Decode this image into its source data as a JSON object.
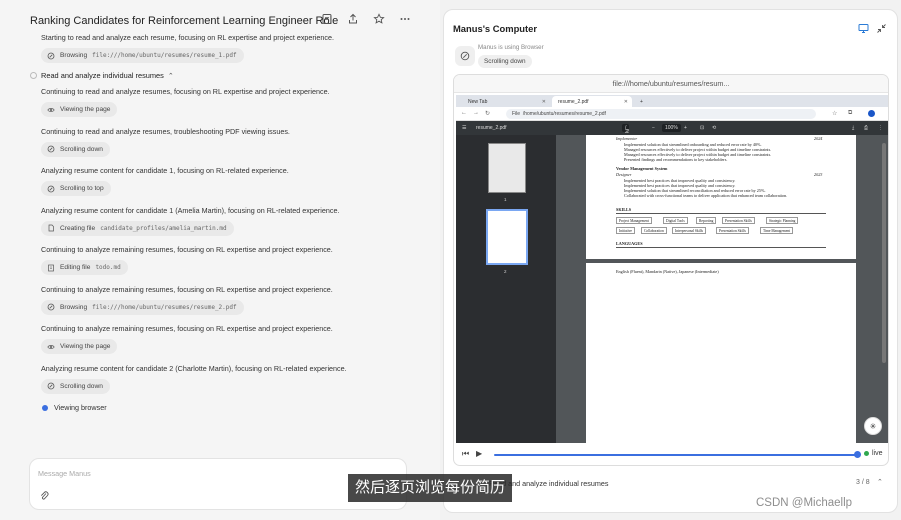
{
  "header": {
    "title": "Ranking Candidates for Reinforcement Learning Engineer Role",
    "icons": [
      "edit-icon",
      "share-icon",
      "star-icon",
      "more-icon"
    ]
  },
  "chat": {
    "intro_text": "Starting to read and analyze each resume, focusing on RL expertise and project experience.",
    "intro_chip": {
      "label": "Browsing",
      "detail": "file:///home/ubuntu/resumes/resume_1.pdf"
    },
    "section": {
      "label": "Read and analyze individual resumes"
    },
    "steps": [
      {
        "text": "Continuing to read and analyze resumes, focusing on RL expertise and project experience.",
        "chip_label": "Viewing the page",
        "chip_detail": "",
        "icon": "eye-icon"
      },
      {
        "text": "Continuing to read and analyze resumes, troubleshooting PDF viewing issues.",
        "chip_label": "Scrolling down",
        "chip_detail": "",
        "icon": "browser-icon"
      },
      {
        "text": "Analyzing resume content for candidate 1, focusing on RL-related experience.",
        "chip_label": "Scrolling to top",
        "chip_detail": "",
        "icon": "browser-icon"
      },
      {
        "text": "Analyzing resume content for candidate 1 (Amelia Martin), focusing on RL-related experience.",
        "chip_label": "Creating file",
        "chip_detail": "candidate_profiles/amelia_martin.md",
        "icon": "file-icon"
      },
      {
        "text": "Continuing to analyze remaining resumes, focusing on RL expertise and project experience.",
        "chip_label": "Editing file",
        "chip_detail": "todo.md",
        "icon": "edit-file-icon"
      },
      {
        "text": "Continuing to analyze remaining resumes, focusing on RL expertise and project experience.",
        "chip_label": "Browsing",
        "chip_detail": "file:///home/ubuntu/resumes/resume_2.pdf",
        "icon": "browser-icon"
      },
      {
        "text": "Continuing to analyze remaining resumes, focusing on RL expertise and project experience.",
        "chip_label": "Viewing the page",
        "chip_detail": "",
        "icon": "eye-icon"
      },
      {
        "text": "Analyzing resume content for candidate 2 (Charlotte Martin), focusing on RL-related experience.",
        "chip_label": "Scrolling down",
        "chip_detail": "",
        "icon": "browser-icon"
      }
    ],
    "current": "Viewing browser",
    "message_placeholder": "Message Manus"
  },
  "computer": {
    "title": "Manus's Computer",
    "using": "Manus is using Browser",
    "action": "Scrolling down",
    "url": "file:///home/ubuntu/resumes/resum...",
    "browser": {
      "tabs": [
        "New Tab",
        "resume_2.pdf"
      ],
      "address": "/home/ubuntu/resumes/resume_2.pdf",
      "address_prefix": "File",
      "pdf_name": "resume_2.pdf",
      "page_current": "2",
      "page_total": "2",
      "zoom": "100%",
      "thumb_labels": [
        "1",
        "2"
      ]
    },
    "pdf": {
      "role1": "Implementer",
      "year1": "2024",
      "bullets1": [
        "Implemented solution that streamlined onboarding and reduced error rate by 40%.",
        "Managed resources effectively to deliver project within budget and timeline constraints.",
        "Managed resources effectively to deliver project within budget and timeline constraints.",
        "Presented findings and recommendations to key stakeholders."
      ],
      "project2": "Vendor Management System",
      "role2": "Designer",
      "year2": "2023",
      "bullets2": [
        "Implemented best practices that improved quality and consistency.",
        "Implemented best practices that improved quality and consistency.",
        "Implemented solution that streamlined reconciliation and reduced error rate by 25%.",
        "Collaborated with cross-functional teams to deliver application that enhanced team collaboration."
      ],
      "skills_heading": "SKILLS",
      "skills": [
        "Project Management",
        "Digital Tools",
        "Reporting",
        "Presentation Skills",
        "Strategic Planning",
        "Initiative",
        "Collaboration",
        "Interpersonal Skills",
        "Presentation Skills",
        "Time Management"
      ],
      "languages_heading": "LANGUAGES",
      "languages": "English (Fluent), Mandarin (Native), Japanese (Intermediate)"
    },
    "live_label": "live",
    "status_text": "Read and analyze individual resumes",
    "status_count": "3 / 8"
  },
  "overlay": {
    "subtitle": "然后逐页浏览每份简历",
    "watermark": "CSDN @Michaellp"
  },
  "colors": {
    "accent": "#3b6fe0",
    "live": "#2fa84f"
  }
}
